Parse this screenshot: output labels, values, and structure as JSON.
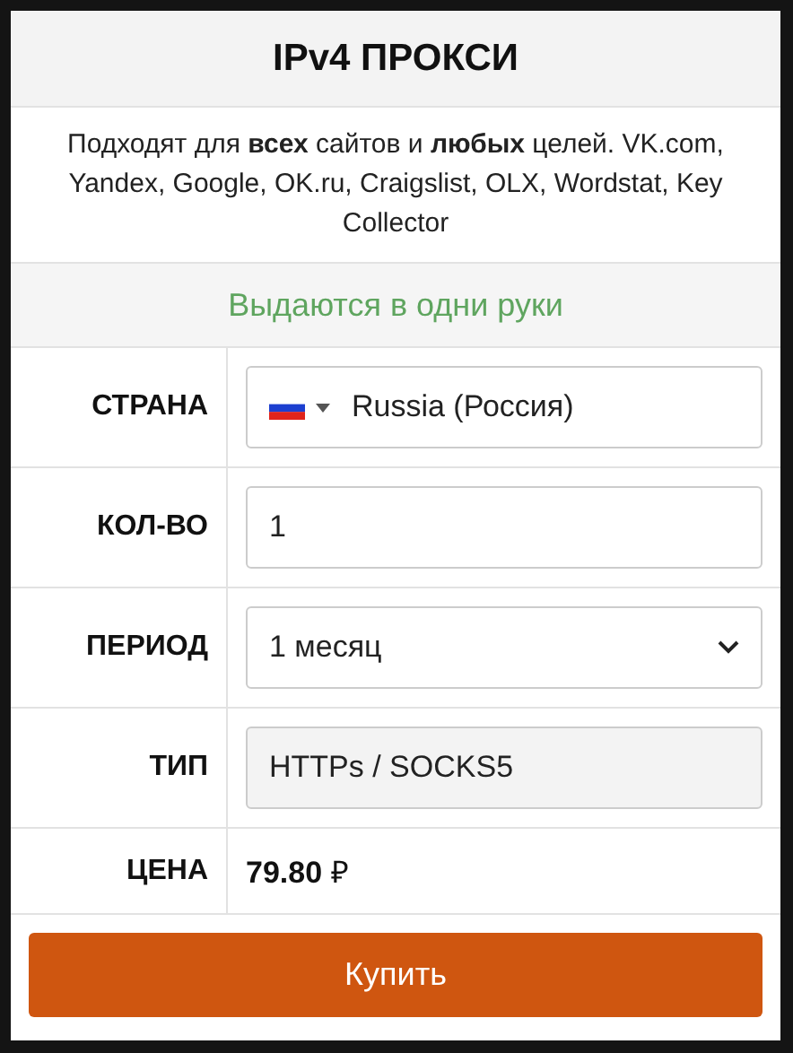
{
  "title": "IPv4 ПРОКСИ",
  "description": "Подходят для **всех** сайтов и **любых** целей. VK.com, Yandex, Google, OK.ru, Craigslist, OLX, Wordstat, Key Collector",
  "notice": "Выдаются в одни руки",
  "rows": [
    {
      "kind": "country",
      "label": "СТРАНА",
      "value": "Russia (Россия)"
    },
    {
      "kind": "input",
      "label": "КОЛ-ВО",
      "value": "1"
    },
    {
      "kind": "select",
      "label": "ПЕРИОД",
      "value": "1 месяц"
    },
    {
      "kind": "readonly",
      "label": "ТИП",
      "value": "HTTPs / SOCKS5"
    },
    {
      "kind": "price",
      "label": "ЦЕНА",
      "value": "**79.80** ₽"
    }
  ],
  "button": "Купить"
}
